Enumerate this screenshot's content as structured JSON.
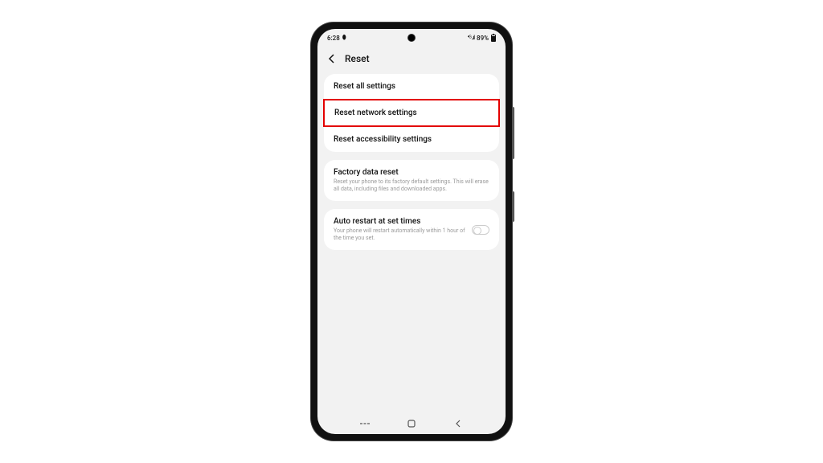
{
  "status": {
    "time": "6:28",
    "recording": "⬮",
    "signal": "⁴ᴳ ..ıl",
    "battery_pct": "89%"
  },
  "header": {
    "title": "Reset"
  },
  "group1": {
    "item1": "Reset all settings",
    "item2": "Reset network settings",
    "item3": "Reset accessibility settings"
  },
  "group2": {
    "title": "Factory data reset",
    "desc": "Reset your phone to its factory default settings. This will erase all data, including files and downloaded apps."
  },
  "group3": {
    "title": "Auto restart at set times",
    "desc": "Your phone will restart automatically within 1 hour of the time you set."
  }
}
